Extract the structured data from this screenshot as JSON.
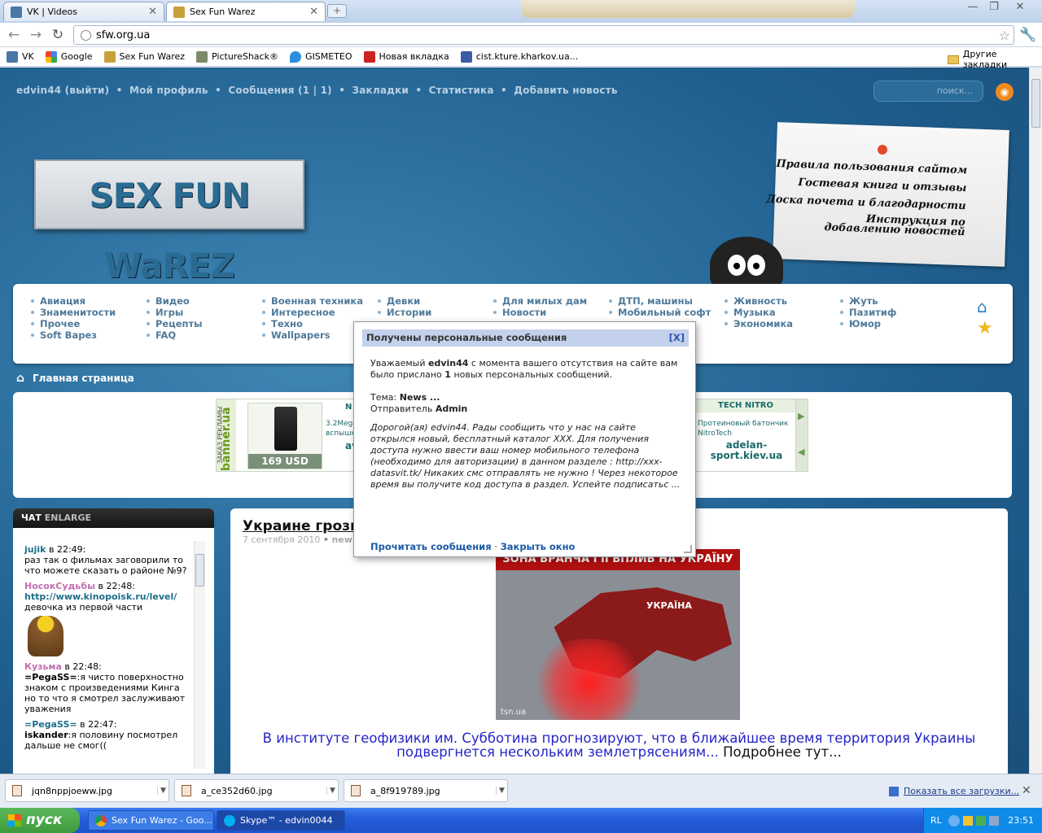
{
  "browser": {
    "tabs": [
      {
        "title": "VK | Videos"
      },
      {
        "title": "Sex Fun Warez"
      }
    ],
    "url": "sfw.org.ua",
    "bookmarks": [
      "VK",
      "Google",
      "Sex Fun Warez",
      "PictureShack®",
      "GISMETEO",
      "Новая вкладка",
      "cist.kture.kharkov.ua..."
    ],
    "other_bookmarks": "Другие закладки"
  },
  "site": {
    "topnav": [
      "edvin44 (выйти)",
      "•",
      "Мой профиль",
      "•",
      "Сообщения (1 | 1)",
      "•",
      "Закладки",
      "•",
      "Статистика",
      "•",
      "Добавить новость"
    ],
    "search_placeholder": "поиск...",
    "rss": "◉",
    "logo": "SEX FUN WaREZ",
    "paper_links": [
      "Правила пользования сайтом",
      "Гостевая книга и отзывы",
      "Доска почета и благодарности",
      "Инструкция по добавлению новостей"
    ],
    "menu": [
      [
        "Авиация",
        "Знаменитости",
        "Прочее",
        "Soft Варез"
      ],
      [
        "Видео",
        "Игры",
        "Рецепты",
        "FAQ"
      ],
      [
        "Военная техника",
        "Интересное",
        "Техно",
        "Wallpapers"
      ],
      [
        "Девки",
        "Истории"
      ],
      [
        "Для милых дам",
        "Новости"
      ],
      [
        "ДТП, машины",
        "Мобильный софт"
      ],
      [
        "Живность",
        "Музыка",
        "Экономика"
      ],
      [
        "Жуть",
        "Пазитиф",
        "Юмор"
      ]
    ],
    "breadcrumb": "Главная страница",
    "banner_left": {
      "vertical": "banner.ua",
      "side": "ЗАКАЗ РЕКЛАМЫ",
      "price": "169 USD",
      "head": "N",
      "text": "3.2Mega",
      "text2": "вспышк",
      "brand": "av"
    },
    "banner_right": {
      "head": "TECH NITRO",
      "text": "Протеиновый батончик NitroTech",
      "link": "adelan-sport.kiev.ua"
    },
    "chat": {
      "title": "ЧАТ",
      "enlarge": "ENLARGE",
      "messages": [
        {
          "nick": "jujik",
          "time": " в 22:49:",
          "text": "раз так о фильмах заговорили то что можете сказать о районе №9?"
        },
        {
          "nick": "НосокСудьбы",
          "time": " в 22:48:",
          "link": "http://www.kinopoisk.ru/level/",
          "text": "девочка из первой части"
        },
        {
          "nick": "Кузьма",
          "time": " в 22:48:",
          "bold": "=PegaSS=",
          "text": ":я чисто поверхностно знаком с произведениями Кинга но то что я смотрел заслуживают уважения"
        },
        {
          "nick": "=PegaSS=",
          "time": " в 22:47:",
          "bold": "iskander",
          "text": ":я половину посмотрел дальше не смог(("
        }
      ]
    },
    "article": {
      "title": "Украине грози",
      "date": "7 сентября 2010",
      "cat": "new",
      "map_banner": "ЗОНА ВРАНЧА І ЇЇ ВПЛИВ НА УКРАЇНУ",
      "map_country": "УКРАЇНА",
      "map_watermark": "tsn.ua",
      "lead": "В институте геофизики им. Субботина прогнозируют, что в ближайшее время территория Украины подвергнется нескольким землетрясениям...",
      "more": " Подробнее тут..."
    }
  },
  "modal": {
    "title": "Получены персональные сообщения",
    "close": "[X]",
    "greet_a": "Уважаемый ",
    "user": "edvin44",
    "greet_b": " с момента вашего отсутствия на сайте вам было прислано ",
    "count": "1",
    "greet_c": " новых персональных сообщений.",
    "subject_label": "Тема: ",
    "subject": "News ...",
    "sender_label": "Отправитель ",
    "sender": "Admin",
    "body": "Дорогой(ая) edvin44. Рады сообщить что у нас на сайте открылся новый, бесплатный каталог XXX. Для получения доступа нужно ввести ваш номер мобильного телефона (необходимо для авторизации) в данном разделе : http://xxx-datasvit.tk/ Никаких смс отправлять не нужно ! Через некоторое время вы получите код доступа в раздел. Успейте подписатьс ...",
    "read": "Прочитать сообщения",
    "sep": " · ",
    "close_window": "Закрыть окно"
  },
  "downloads": {
    "items": [
      "jqn8nppjoeww.jpg",
      "a_ce352d60.jpg",
      "a_8f919789.jpg"
    ],
    "show_all": "Показать все загрузки..."
  },
  "taskbar": {
    "start": "пуск",
    "tasks": [
      "Sex Fun Warez - Goo...",
      "Skype™ - edvin0044"
    ],
    "lang": "RL",
    "clock": "23:51"
  },
  "colors": {
    "accent": "#2b7bc6",
    "modal_header": "#c3d1ec",
    "link": "#1d5aa5"
  }
}
